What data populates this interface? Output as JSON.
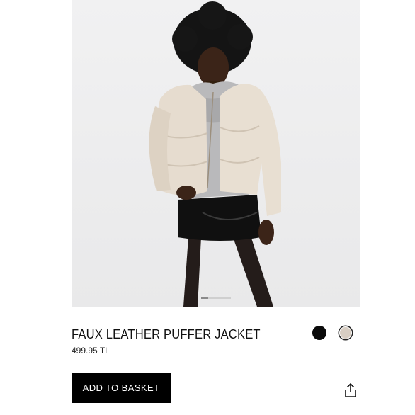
{
  "product": {
    "title": "FAUX LEATHER PUFFER JACKET",
    "price": "499.95 TL",
    "image_alt": "Model wearing cream faux leather puffer jacket, grey hoodie and black mini skirt"
  },
  "carousel": {
    "current_index": 1,
    "total": 4
  },
  "colors": {
    "options": [
      {
        "name": "black",
        "hex": "#0a0a0a"
      },
      {
        "name": "beige",
        "hex": "#d8cec3"
      }
    ],
    "selected": "beige"
  },
  "actions": {
    "add_to_basket_label": "ADD TO BASKET",
    "share_icon": "share-icon"
  }
}
